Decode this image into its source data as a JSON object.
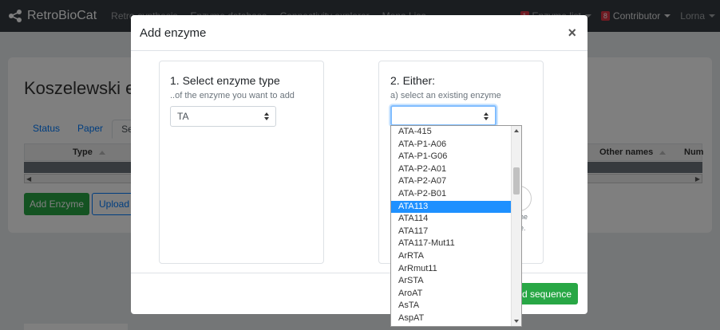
{
  "navbar": {
    "brand": "RetroBioCat",
    "links": [
      "Retro-synthesis",
      "Enzyme database",
      "Connectivity explorer",
      "Mona Lisa"
    ],
    "right": {
      "badge1": "1",
      "item1": "Enzyme list",
      "badge2": "8",
      "contributor": "Contributor",
      "user": "Lorna"
    }
  },
  "page": {
    "title": "Koszelewski et al",
    "tabs": [
      "Status",
      "Paper",
      "Sequences"
    ],
    "table_headers": [
      "Type",
      "Other names",
      "Num"
    ],
    "add_enzyme_button": "Add Enzyme",
    "upload_button": "Upload"
  },
  "modal": {
    "title": "Add enzyme",
    "close": "×",
    "step1": {
      "title": "1. Select enzyme type",
      "subtitle": "..of the enzyme you want to add",
      "selected_type": "TA"
    },
    "step2": {
      "title": "2. Either:",
      "subtitle": "a) select an existing enzyme",
      "selected_enzyme": "",
      "hidden_hint_1": "he",
      "hidden_hint_2": "e."
    },
    "footer_button": "Add sequence"
  },
  "dropdown": {
    "selected_index": 6,
    "options": [
      "ATA-415",
      "ATA-P1-A06",
      "ATA-P1-G06",
      "ATA-P2-A01",
      "ATA-P2-A07",
      "ATA-P2-B01",
      "ATA113",
      "ATA114",
      "ATA117",
      "ATA117-Mut11",
      "ArRTA",
      "ArRmut11",
      "ArSTA",
      "AroAT",
      "AsTA",
      "AspAT"
    ]
  }
}
